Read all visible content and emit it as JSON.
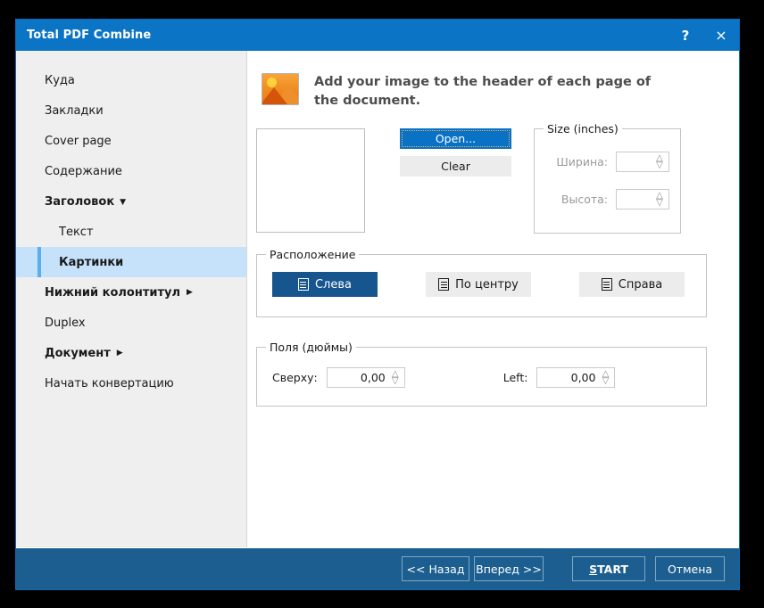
{
  "window": {
    "title": "Total PDF Combine",
    "help_label": "?",
    "close_label": "×"
  },
  "sidebar": {
    "items": [
      {
        "label": "Куда",
        "level": 0,
        "bold": false,
        "selected": false,
        "caret": ""
      },
      {
        "label": "Закладки",
        "level": 0,
        "bold": false,
        "selected": false,
        "caret": ""
      },
      {
        "label": "Cover page",
        "level": 0,
        "bold": false,
        "selected": false,
        "caret": ""
      },
      {
        "label": "Содержание",
        "level": 0,
        "bold": false,
        "selected": false,
        "caret": ""
      },
      {
        "label": "Заголовок",
        "level": 0,
        "bold": true,
        "selected": false,
        "caret": "down"
      },
      {
        "label": "Текст",
        "level": 1,
        "bold": false,
        "selected": false,
        "caret": ""
      },
      {
        "label": "Картинки",
        "level": 1,
        "bold": true,
        "selected": true,
        "caret": ""
      },
      {
        "label": "Нижний колонтитул",
        "level": 0,
        "bold": true,
        "selected": false,
        "caret": "right"
      },
      {
        "label": "Duplex",
        "level": 0,
        "bold": false,
        "selected": false,
        "caret": ""
      },
      {
        "label": "Документ",
        "level": 0,
        "bold": true,
        "selected": false,
        "caret": "right"
      },
      {
        "label": "Начать конвертацию",
        "level": 0,
        "bold": false,
        "selected": false,
        "caret": ""
      }
    ]
  },
  "main": {
    "header_text": "Add your image to the header of each page of the document.",
    "buttons": {
      "open": "Open...",
      "clear": "Clear"
    },
    "size_group": {
      "legend": "Size (inches)",
      "width_label": "Ширина:",
      "width_value": "",
      "height_label": "Высота:",
      "height_value": ""
    },
    "position_group": {
      "legend": "Расположение",
      "left": "Слева",
      "center": "По центру",
      "right": "Справа",
      "selected": "Слева"
    },
    "margins_group": {
      "legend": "Поля (дюймы)",
      "top_label": "Сверху:",
      "top_value": "0,00",
      "left_label": "Left:",
      "left_value": "0,00"
    }
  },
  "footer": {
    "back": "<< Назад",
    "forward": "Вперед >>",
    "start_prefix": "S",
    "start_suffix": "TART",
    "cancel": "Отмена"
  },
  "colors": {
    "titlebar": "#0b74c4",
    "accent": "#0a72c4",
    "footer": "#1c5e8f",
    "selection": "#c6e2fb",
    "active_button": "#17558f"
  }
}
